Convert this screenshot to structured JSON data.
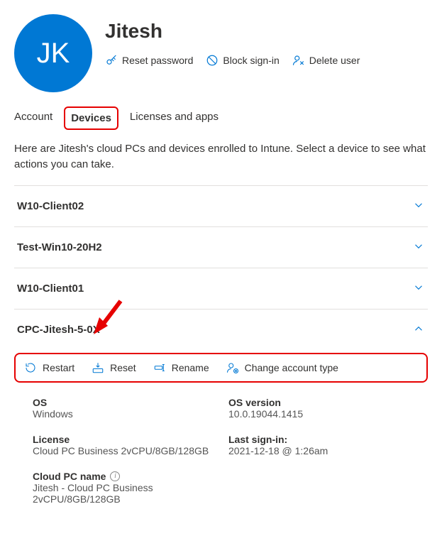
{
  "user": {
    "initials": "JK",
    "name": "Jitesh"
  },
  "header_actions": {
    "reset_password": "Reset password",
    "block_signin": "Block sign-in",
    "delete_user": "Delete user"
  },
  "tabs": {
    "account": "Account",
    "devices": "Devices",
    "licenses": "Licenses and apps"
  },
  "description": "Here are Jitesh's cloud PCs and devices enrolled to Intune. Select a device to see what actions you can take.",
  "devices": {
    "d0": "W10-Client02",
    "d1": "Test-Win10-20H2",
    "d2": "W10-Client01",
    "d3": "CPC-Jitesh-5-0X"
  },
  "device_actions": {
    "restart": "Restart",
    "reset": "Reset",
    "rename": "Rename",
    "change_account": "Change account type"
  },
  "details": {
    "os_label": "OS",
    "os_value": "Windows",
    "osversion_label": "OS version",
    "osversion_value": "10.0.19044.1415",
    "license_label": "License",
    "license_value": "Cloud PC Business 2vCPU/8GB/128GB",
    "lastsignin_label": "Last sign-in:",
    "lastsignin_value": "2021-12-18 @ 1:26am",
    "cloudpc_label": "Cloud PC name",
    "cloudpc_value": "Jitesh - Cloud PC Business 2vCPU/8GB/128GB"
  },
  "colors": {
    "primary": "#0078d4",
    "highlight": "#e60000"
  }
}
